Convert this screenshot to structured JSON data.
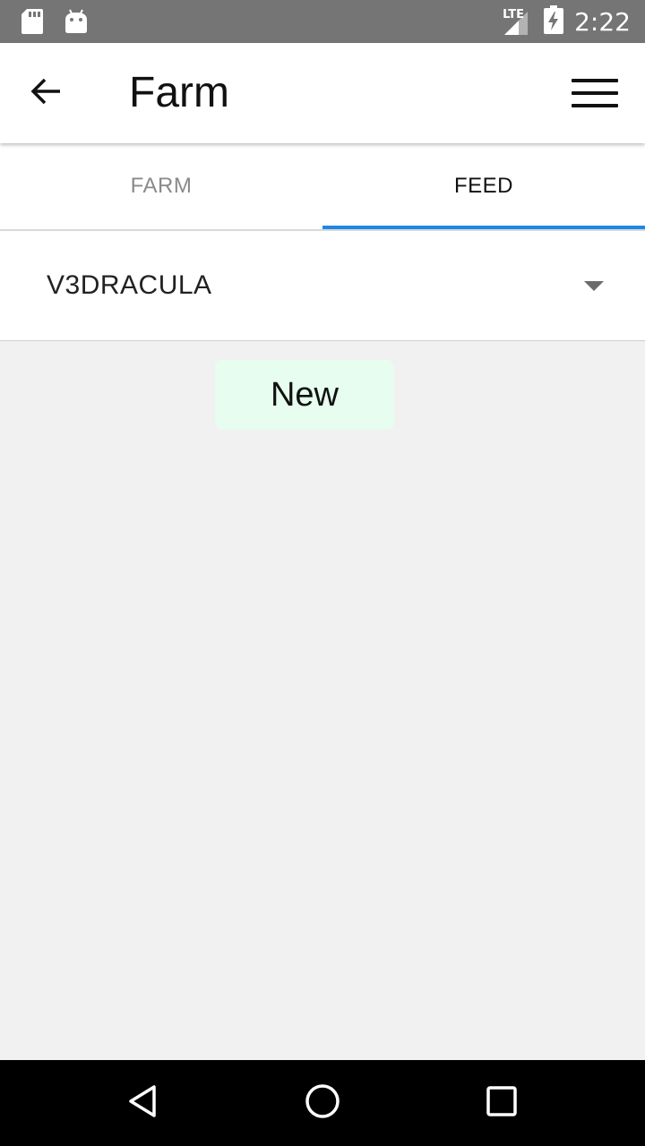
{
  "status_bar": {
    "time": "2:22",
    "network": "LTE",
    "icons": [
      "sd-card-icon",
      "android-icon",
      "signal-icon",
      "battery-charging-icon"
    ]
  },
  "app_bar": {
    "title": "Farm",
    "back_icon": "arrow-left-icon",
    "menu_icon": "hamburger-menu-icon"
  },
  "tabs": [
    {
      "label": "FARM",
      "selected": false
    },
    {
      "label": "FEED",
      "selected": true
    }
  ],
  "dropdown": {
    "selected_value": "V3DRACULA",
    "icon": "caret-down-icon"
  },
  "actions": {
    "new_label": "New"
  },
  "nav_bar": {
    "icons": [
      "back-triangle-icon",
      "home-circle-icon",
      "recents-square-icon"
    ]
  },
  "colors": {
    "accent": "#1e88e5",
    "status_bar": "#757575",
    "new_button_bg": "#e6fdef",
    "background": "#f1f1f1"
  }
}
